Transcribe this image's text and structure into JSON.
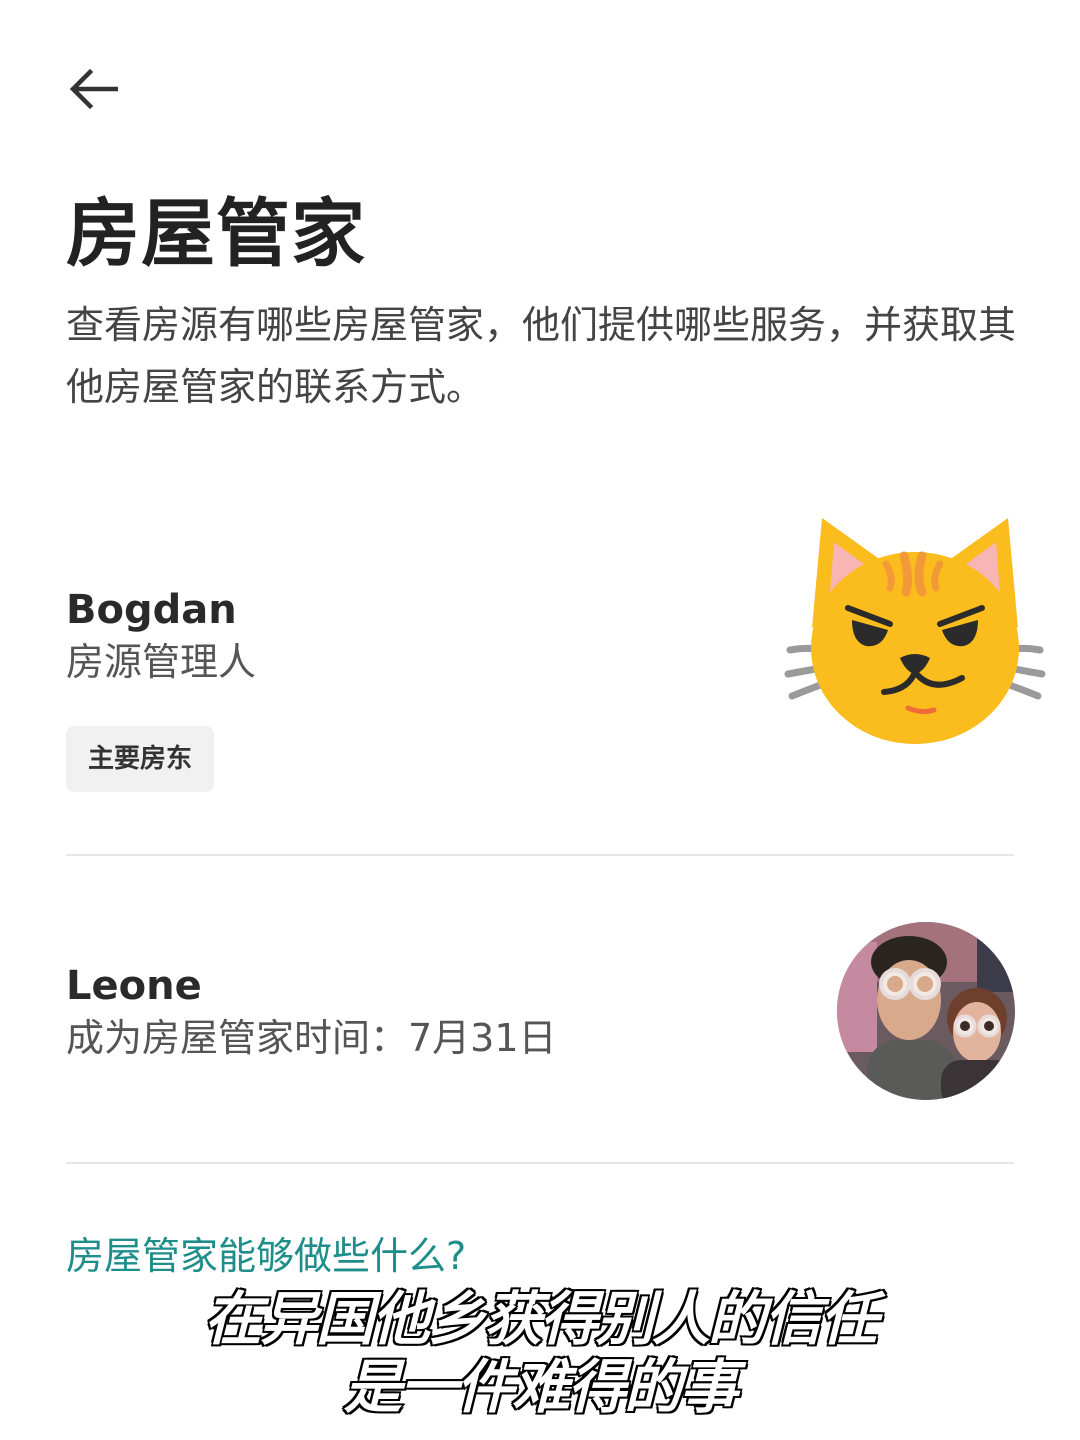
{
  "header": {
    "back_icon": "arrow-left-icon",
    "title": "房屋管家",
    "subtitle": "查看房源有哪些房屋管家，他们提供哪些服务，并获取其他房屋管家的联系方式。"
  },
  "hosts": [
    {
      "name": "Bogdan",
      "detail": "房源管理人",
      "badge": "主要房东",
      "avatar": "cat-emoji-avatar"
    },
    {
      "name": "Leone",
      "detail": "成为房屋管家时间：7月31日",
      "avatar": "photo-avatar"
    }
  ],
  "faq": {
    "link_text": "房屋管家能够做些什么?"
  },
  "caption": {
    "line1": "在异国他乡获得别人的信任",
    "line2": "是一件难得的事"
  },
  "colors": {
    "link": "#1f8e8a",
    "divider": "#e6e6e6",
    "badge_bg": "#f1f1f1"
  }
}
